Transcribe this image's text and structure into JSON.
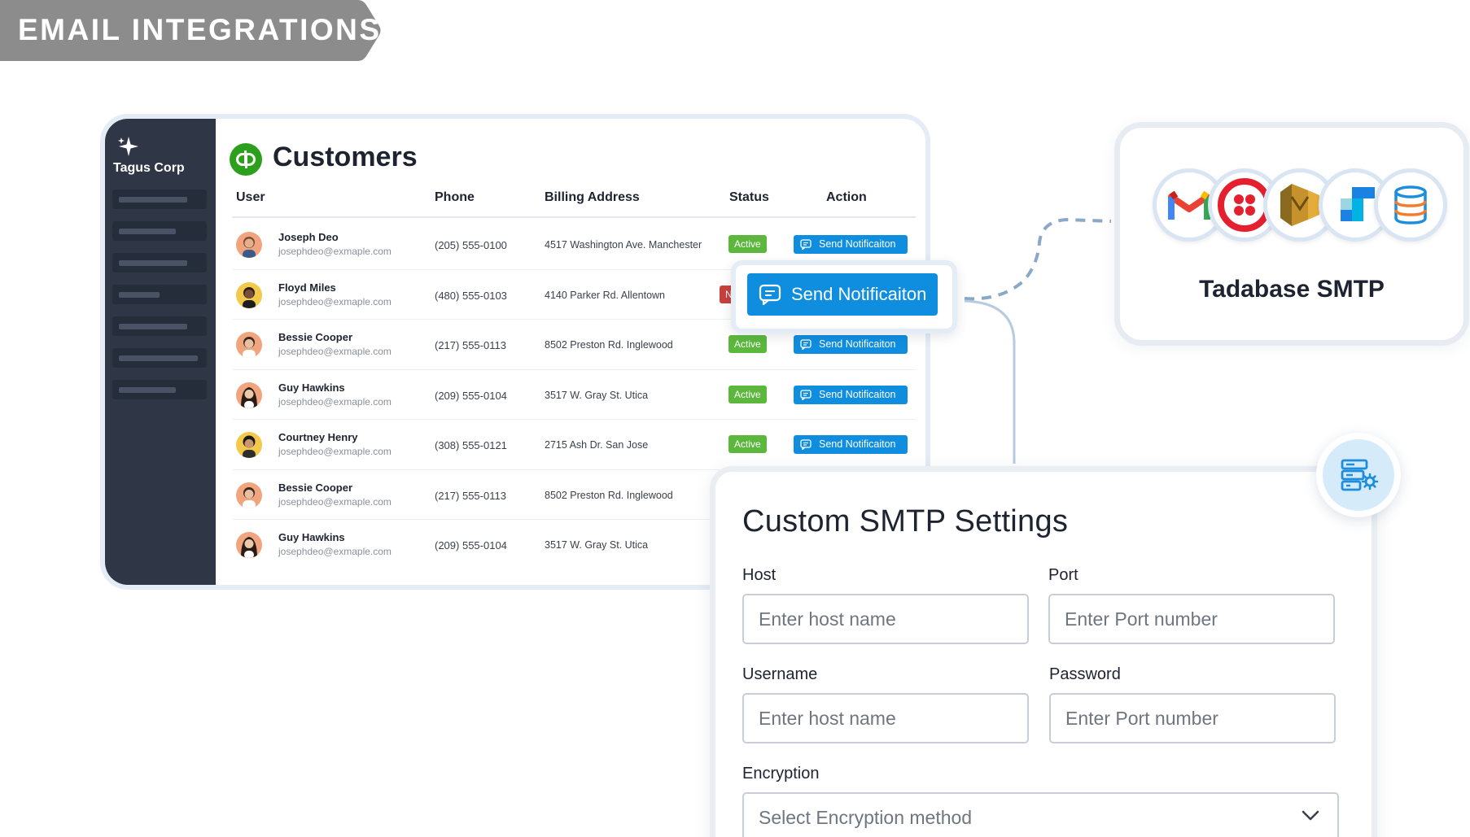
{
  "banner": {
    "label": "EMAIL INTEGRATIONS"
  },
  "app": {
    "brand": "Tagus Corp",
    "sidebar_items": 7,
    "page_title": "Customers",
    "columns": {
      "user": "User",
      "phone": "Phone",
      "billing": "Billing Address",
      "status": "Status",
      "action": "Action"
    },
    "rows": [
      {
        "name": "Joseph Deo",
        "email": "josephdeo@exmaple.com",
        "phone": "(205) 555-0100",
        "address": "4517 Washington Ave. Manchester",
        "status": "Active",
        "action": "Send Notificaiton"
      },
      {
        "name": "Floyd Miles",
        "email": "josephdeo@exmaple.com",
        "phone": "(480) 555-0103",
        "address": "4140 Parker Rd. Allentown",
        "status": "Not-A",
        "action": ""
      },
      {
        "name": "Bessie Cooper",
        "email": "josephdeo@exmaple.com",
        "phone": "(217) 555-0113",
        "address": "8502 Preston Rd. Inglewood",
        "status": "Active",
        "action": "Send Notificaiton"
      },
      {
        "name": "Guy Hawkins",
        "email": "josephdeo@exmaple.com",
        "phone": "(209) 555-0104",
        "address": "3517 W. Gray St. Utica",
        "status": "Active",
        "action": "Send Notificaiton"
      },
      {
        "name": "Courtney Henry",
        "email": "josephdeo@exmaple.com",
        "phone": "(308) 555-0121",
        "address": "2715 Ash Dr. San Jose",
        "status": "Active",
        "action": "Send Notificaiton"
      },
      {
        "name": "Bessie Cooper",
        "email": "josephdeo@exmaple.com",
        "phone": "(217) 555-0113",
        "address": "8502 Preston Rd. Inglewood",
        "status": "",
        "action": ""
      },
      {
        "name": "Guy Hawkins",
        "email": "josephdeo@exmaple.com",
        "phone": "(209) 555-0104",
        "address": "3517 W. Gray St. Utica",
        "status": "",
        "action": ""
      }
    ],
    "floating_button": "Send Notificaiton"
  },
  "smtp": {
    "title": "Tadabase SMTP",
    "providers": [
      "gmail-icon",
      "twilio-icon",
      "amazon-ses-icon",
      "sendgrid-icon",
      "database-icon"
    ]
  },
  "settings": {
    "title": "Custom SMTP Settings",
    "host_label": "Host",
    "host_placeholder": "Enter host name",
    "port_label": "Port",
    "port_placeholder": "Enter Port number",
    "username_label": "Username",
    "username_placeholder": "Enter host name",
    "password_label": "Password",
    "password_placeholder": "Enter Port number",
    "encryption_label": "Encryption",
    "encryption_placeholder": "Select Encryption method"
  },
  "colors": {
    "banner_gray": "#8c8c8c",
    "sidebar": "#2f3746",
    "primary_blue": "#0f8ee0",
    "active_green": "#5cb83d",
    "inactive_red": "#c8403c",
    "quickbooks_green": "#2ca01c"
  }
}
